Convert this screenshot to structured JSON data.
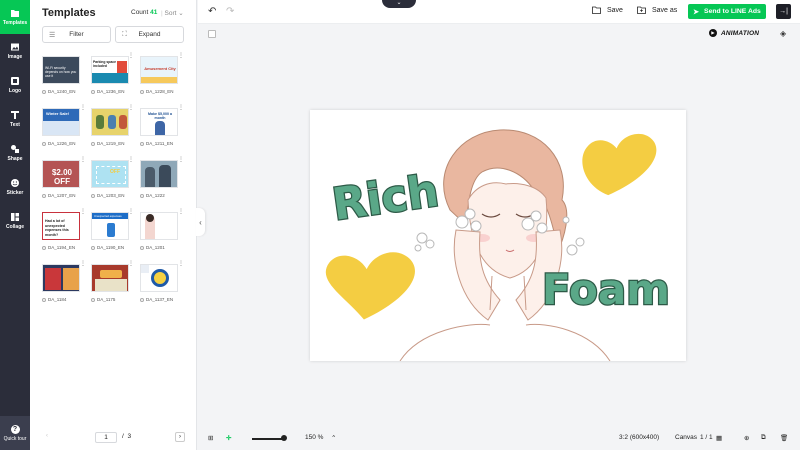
{
  "rail": {
    "items": [
      {
        "label": "Templates",
        "icon": "templates-icon"
      },
      {
        "label": "Image",
        "icon": "image-icon"
      },
      {
        "label": "Logo",
        "icon": "logo-icon"
      },
      {
        "label": "Text",
        "icon": "text-icon"
      },
      {
        "label": "Shape",
        "icon": "shape-icon"
      },
      {
        "label": "Sticker",
        "icon": "sticker-icon"
      },
      {
        "label": "Collage",
        "icon": "collage-icon"
      }
    ],
    "quick_tour": "Quick tour",
    "accent": "#06c755",
    "background": "#2b2d3a"
  },
  "panel": {
    "title": "Templates",
    "count_label": "Count",
    "count_value": "41",
    "sort_label": "Sort",
    "filter_label": "Filter",
    "expand_label": "Expand",
    "templates": [
      {
        "name": "DA_1240_EN",
        "thumb_text": "Wi-Fi security depends on how you use it"
      },
      {
        "name": "DA_1236_EN",
        "thumb_text": "Parking space included"
      },
      {
        "name": "DA_1228_EN",
        "thumb_text": "Amusement City"
      },
      {
        "name": "DA_1226_EN",
        "thumb_text": "Winter Sale!"
      },
      {
        "name": "DA_1219_EN",
        "thumb_text": ""
      },
      {
        "name": "DA_1211_EN",
        "thumb_text": "Make $5,000 a month"
      },
      {
        "name": "DA_1207_EN",
        "thumb_text": "$2.00 OFF"
      },
      {
        "name": "DA_1203_EN",
        "thumb_text": "OFF"
      },
      {
        "name": "DA_1222",
        "thumb_text": ""
      },
      {
        "name": "DA_1194_EN",
        "thumb_text": "Had a lot of unexpected expenses this month?"
      },
      {
        "name": "DA_1190_EN",
        "thumb_text": "Unexpected expenses"
      },
      {
        "name": "DA_1201",
        "thumb_text": ""
      },
      {
        "name": "DA_1184",
        "thumb_text": ""
      },
      {
        "name": "DA_1175",
        "thumb_text": ""
      },
      {
        "name": "DA_1137_EN",
        "thumb_text": ""
      }
    ],
    "pager": {
      "current": "1",
      "separator": "/",
      "total": "3"
    }
  },
  "toolbar": {
    "save_label": "Save",
    "save_as_label": "Save as",
    "send_label": "Send to LINE Ads",
    "animation_label": "ANIMATION"
  },
  "canvas": {
    "text_1": "Rich",
    "text_2": "Foam",
    "text_color": "#5aa888",
    "heart_color": "#f4cd42",
    "background": "#ffffff"
  },
  "bottombar": {
    "zoom_label": "150 %",
    "size_label": "3:2 (600x400)",
    "canvas_label": "Canvas",
    "canvas_page": "1 / 1"
  }
}
